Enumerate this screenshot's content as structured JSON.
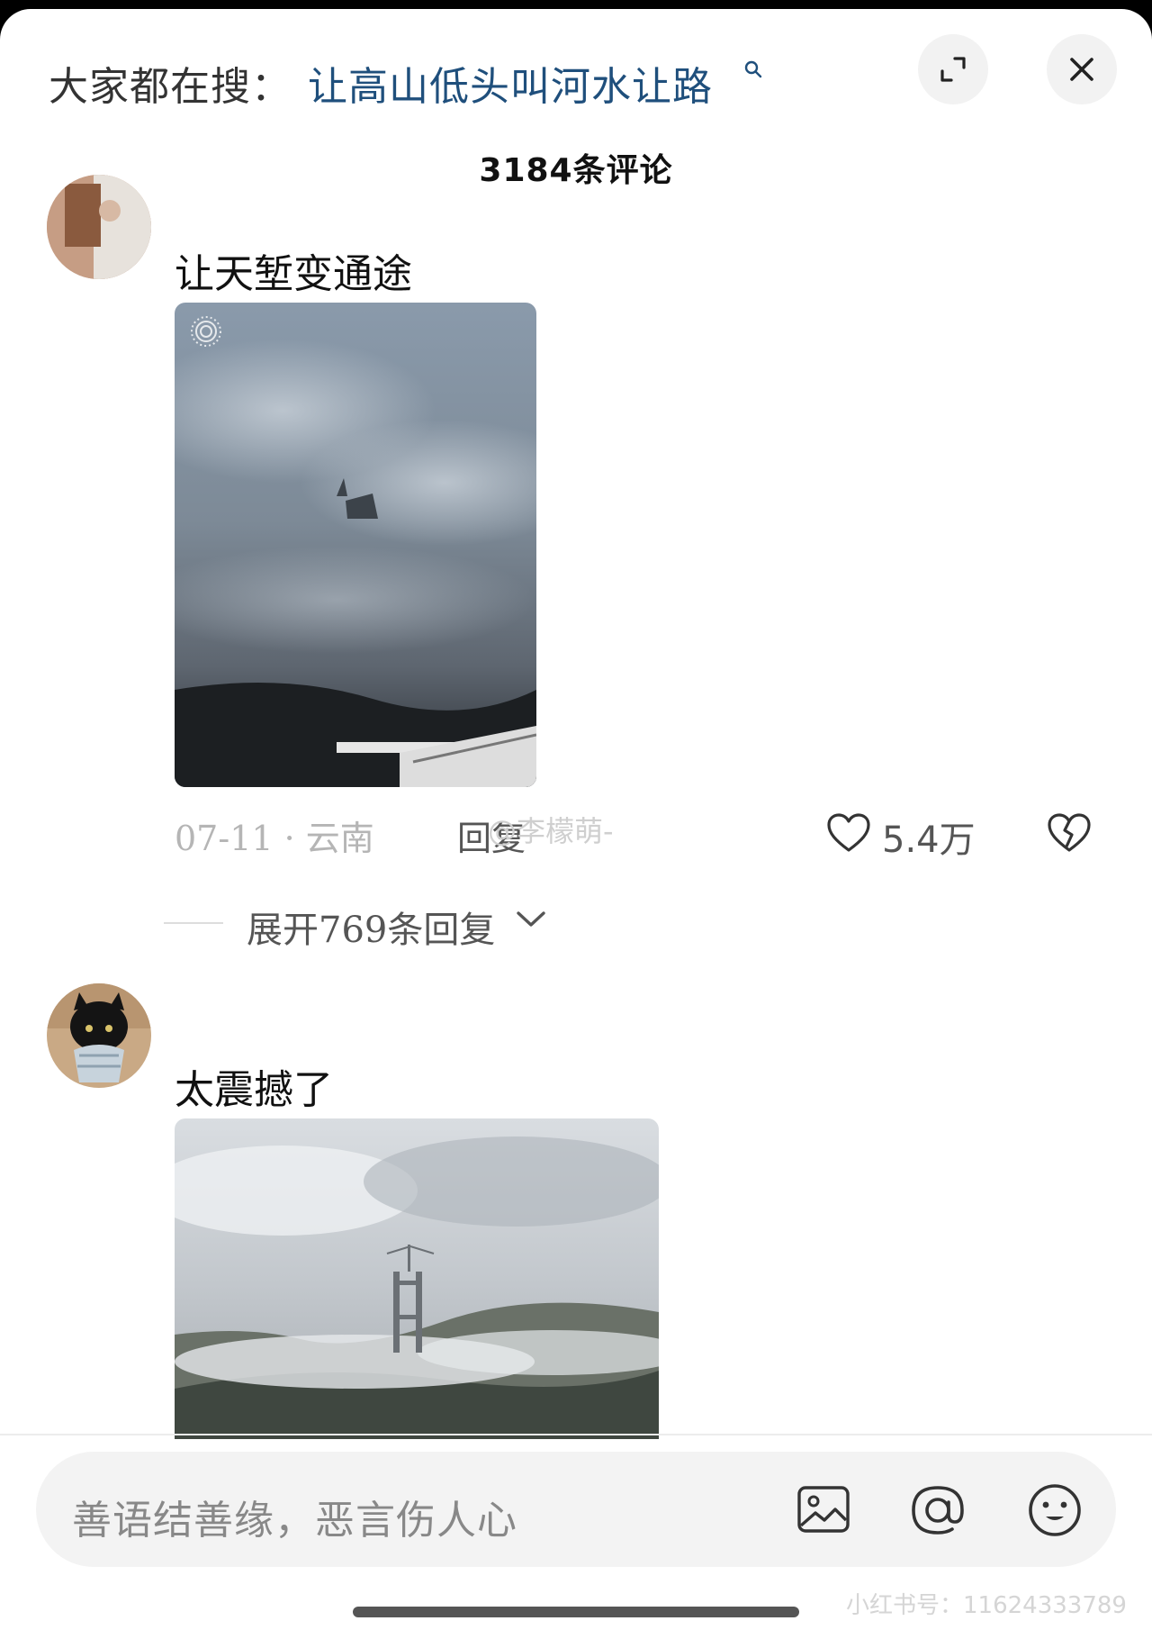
{
  "header": {
    "search_prefix": "大家都在搜：",
    "search_term": "让高山低头叫河水让路"
  },
  "comment_count": "3184条评论",
  "comments": [
    {
      "text": "让天堑变通途",
      "date_location": "07-11 · 云南",
      "reply_label": "回复",
      "like_count": "5.4万",
      "expand_replies": "展开769条回复"
    },
    {
      "text": "太震撼了"
    }
  ],
  "watermarks": {
    "weibo": "@李檬萌-",
    "xhs": "小红书号：11624333789"
  },
  "input": {
    "placeholder": "善语结善缘，恶言伤人心"
  },
  "colors": {
    "search_term": "#1f4f7c",
    "meta": "#b5b5b5",
    "input_bg": "#f3f3f3"
  }
}
